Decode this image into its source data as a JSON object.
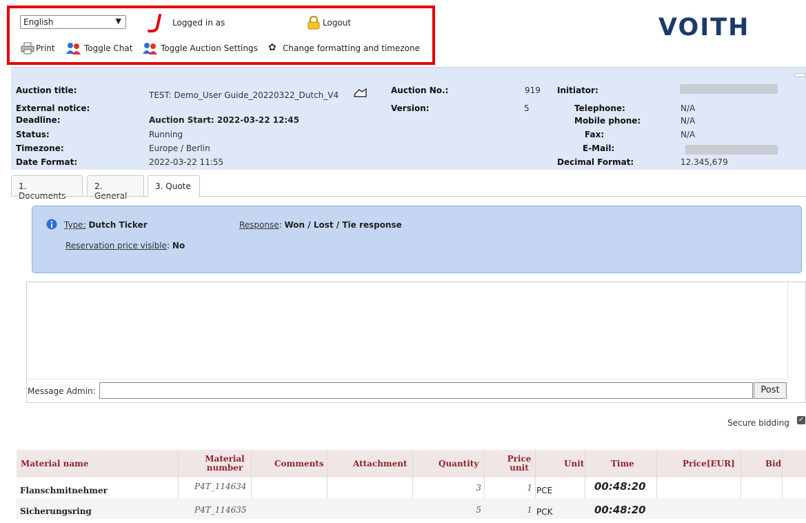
{
  "toolbar": {
    "language": "English",
    "logged_in": "Logged in as",
    "logout": "Logout",
    "print": "Print",
    "toggle_chat": "Toggle Chat",
    "toggle_auction_settings": "Toggle Auction Settings",
    "change_formatting": "Change formatting and timezone",
    "highlight_color": "#e60000"
  },
  "brand": {
    "logo_text": "VOITH",
    "color": "#1b3a6b"
  },
  "auction": {
    "title_label": "Auction title:",
    "title_value": "TEST: Demo_User Guide_20220322_Dutch_V4",
    "external_notice_label": "External notice:",
    "deadline_label": "Deadline:",
    "deadline_value": "Auction Start: 2022-03-22 12:45",
    "status_label": "Status:",
    "status_value": "Running",
    "timezone_label": "Timezone:",
    "timezone_value": "Europe / Berlin",
    "date_format_label": "Date Format:",
    "date_format_value": "2022-03-22 11:55",
    "auction_no_label": "Auction No.:",
    "auction_no_value": "919",
    "version_label": "Version:",
    "version_value": "5",
    "initiator_label": "Initiator:",
    "telephone_label": "Telephone:",
    "telephone_value": "N/A",
    "mobile_label": "Mobile phone:",
    "mobile_value": "N/A",
    "fax_label": "Fax:",
    "fax_value": "N/A",
    "email_label": "E-Mail:",
    "decimal_label": "Decimal Format:",
    "decimal_value": "12.345,679"
  },
  "tabs": [
    "1. Documents",
    "2. General",
    "3. Quote"
  ],
  "active_tab": "3. Quote",
  "quote_info": {
    "type_label": "Type:",
    "type_value": "Dutch Ticker",
    "response_label": "Response",
    "response_value": "Won / Lost / Tie response",
    "reservation_label": "Reservation price visible",
    "reservation_value": "No"
  },
  "chat": {
    "message_label": "Message Admin:",
    "post_label": "Post"
  },
  "secure_bidding": "Secure bidding",
  "table": {
    "headers": {
      "material_name": "Material name",
      "material_number": "Material number",
      "comments": "Comments",
      "attachment": "Attachment",
      "quantity": "Quantity",
      "price_unit": "Price unit",
      "unit": "Unit",
      "time": "Time",
      "price": "Price[EUR]",
      "bid": "Bid"
    },
    "rows": [
      {
        "name": "Flanschmitnehmer",
        "number": "P4T_114634",
        "quantity": "3",
        "price_unit": "1",
        "unit": "PCE",
        "time": "00:48:20"
      },
      {
        "name": "Sicherungsring",
        "number": "P4T_114635",
        "quantity": "5",
        "price_unit": "1",
        "unit": "PCK",
        "time": "00:48:20"
      }
    ]
  }
}
